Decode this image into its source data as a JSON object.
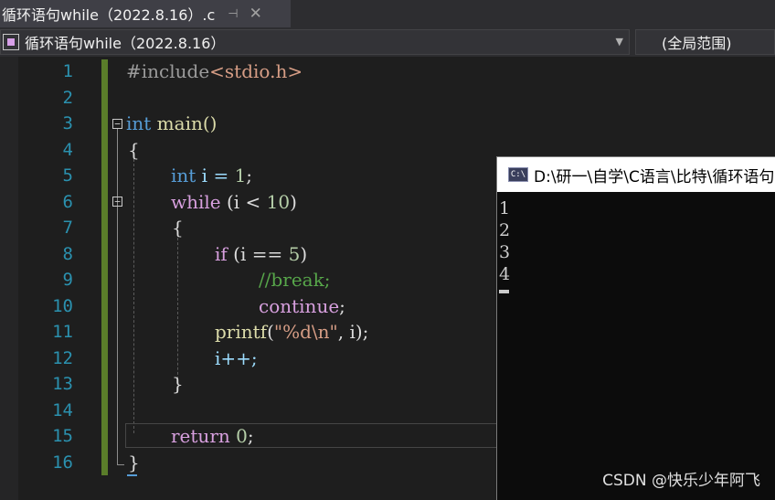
{
  "tab": {
    "title": "循环语句while（2022.8.16）.c",
    "pin_icon": "pin-icon",
    "close_icon": "close-icon"
  },
  "navbar": {
    "project": "循环语句while（2022.8.16）",
    "scope": "(全局范围)"
  },
  "editor": {
    "line_numbers": [
      "1",
      "2",
      "3",
      "4",
      "5",
      "6",
      "7",
      "8",
      "9",
      "10",
      "11",
      "12",
      "13",
      "14",
      "15",
      "16"
    ],
    "code": {
      "l1": [
        "#include",
        "<stdio.h>"
      ],
      "l3": [
        "int",
        " main()"
      ],
      "l4": "{",
      "l5": [
        "int",
        " i = ",
        "1",
        ";"
      ],
      "l6": [
        "while",
        " (i < ",
        "10",
        ")"
      ],
      "l7": "{",
      "l8": [
        "if",
        " (i == ",
        "5",
        ")"
      ],
      "l9": "//break;",
      "l10": [
        "continue",
        ";"
      ],
      "l11": [
        "printf",
        "(",
        "\"%d\\n\"",
        ", i);"
      ],
      "l12": "i++;",
      "l13": "}",
      "l15": [
        "return",
        " ",
        "0",
        ";"
      ],
      "l16": "}"
    }
  },
  "console": {
    "title": "D:\\研一\\自学\\C语言\\比特\\循环语句",
    "icon_text": "C:\\",
    "output": [
      "1",
      "2",
      "3",
      "4"
    ]
  },
  "watermark": "CSDN @快乐少年阿飞"
}
